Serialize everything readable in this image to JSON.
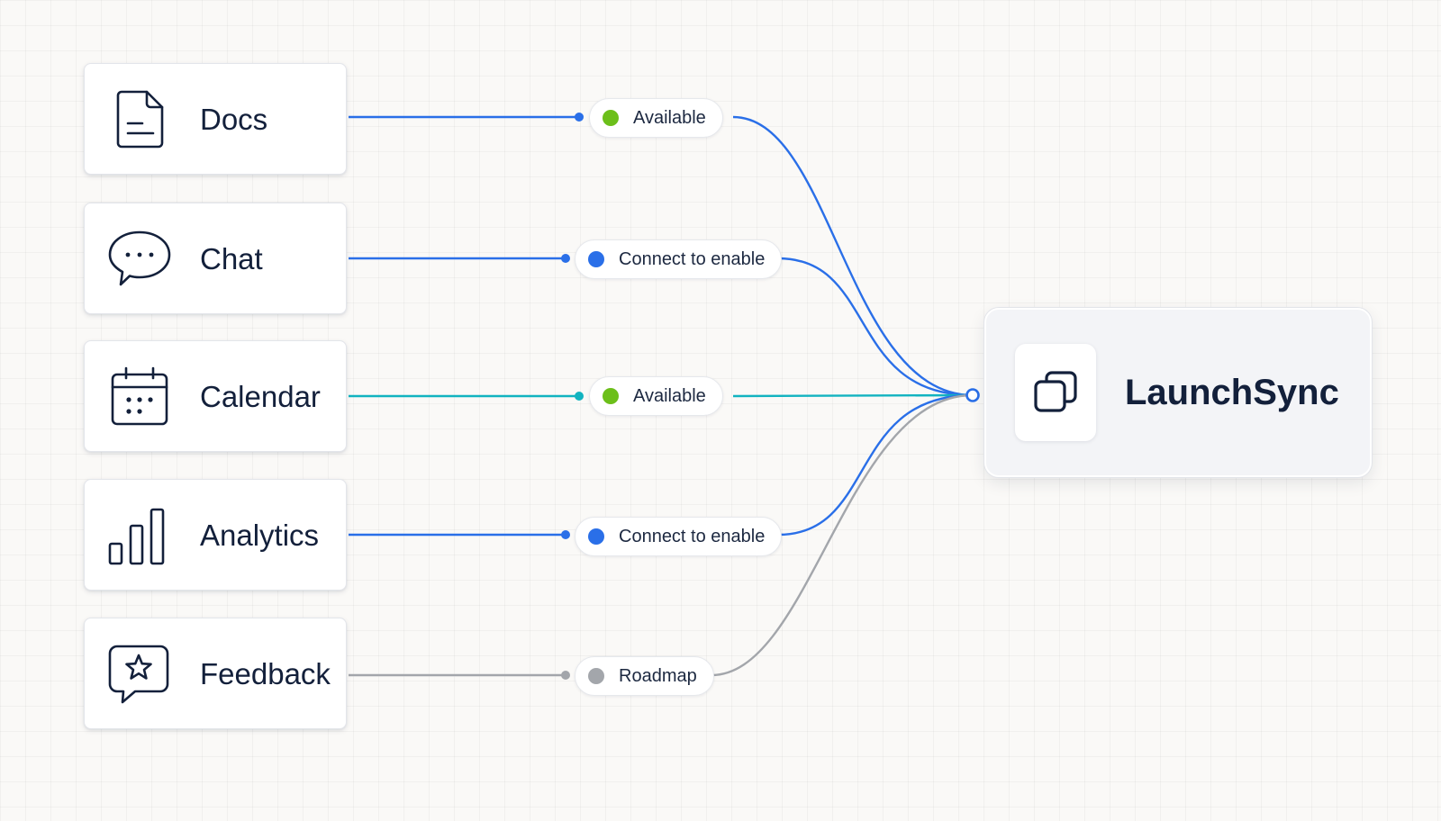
{
  "hub": {
    "title": "LaunchSync",
    "icon": "copy-icon"
  },
  "status_colors": {
    "available": "#6cbf1a",
    "connect": "#2a6fe8",
    "roadmap": "#a3a6ab"
  },
  "wire_colors": {
    "blue": "#2a6fe8",
    "teal": "#12b3c0",
    "gray": "#a3a6ab"
  },
  "sources": [
    {
      "label": "Docs",
      "icon": "document-icon",
      "status": "Available",
      "status_kind": "available",
      "wire": "blue"
    },
    {
      "label": "Chat",
      "icon": "chat-bubble-icon",
      "status": "Connect to enable",
      "status_kind": "connect",
      "wire": "blue"
    },
    {
      "label": "Calendar",
      "icon": "calendar-icon",
      "status": "Available",
      "status_kind": "available",
      "wire": "teal"
    },
    {
      "label": "Analytics",
      "icon": "bar-chart-icon",
      "status": "Connect to enable",
      "status_kind": "connect",
      "wire": "blue"
    },
    {
      "label": "Feedback",
      "icon": "feedback-star-icon",
      "status": "Roadmap",
      "status_kind": "roadmap",
      "wire": "gray"
    }
  ]
}
